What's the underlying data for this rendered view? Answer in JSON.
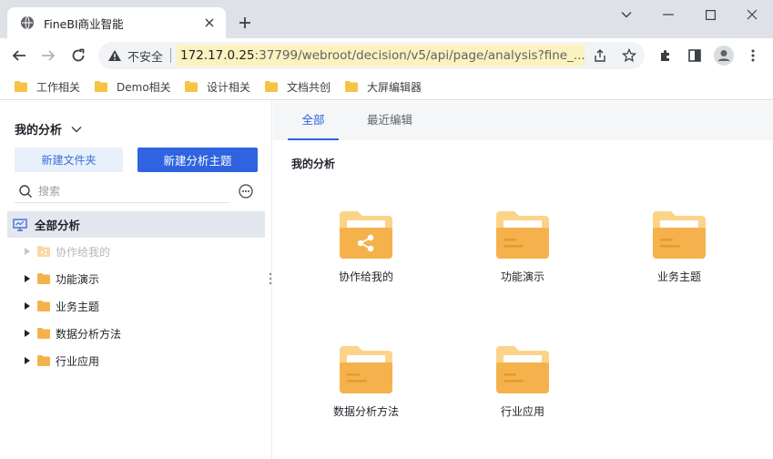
{
  "browser": {
    "tab_title": "FineBI商业智能",
    "security_label": "不安全",
    "url_host": "172.17.0.25",
    "url_rest": ":37799/webroot/decision/v5/api/page/analysis?fine_...",
    "bookmarks": [
      "工作相关",
      "Demo相关",
      "设计相关",
      "文档共创",
      "大屏编辑器"
    ]
  },
  "sidebar": {
    "title": "我的分析",
    "new_folder_label": "新建文件夹",
    "new_topic_label": "新建分析主题",
    "search_placeholder": "搜索",
    "tree": {
      "root_label": "全部分析",
      "items": [
        {
          "label": "协作给我的",
          "disabled": true
        },
        {
          "label": "功能演示",
          "disabled": false
        },
        {
          "label": "业务主题",
          "disabled": false
        },
        {
          "label": "数据分析方法",
          "disabled": false
        },
        {
          "label": "行业应用",
          "disabled": false
        }
      ]
    }
  },
  "main": {
    "tabs": [
      {
        "label": "全部",
        "active": true
      },
      {
        "label": "最近编辑",
        "active": false
      }
    ],
    "section_title": "我的分析",
    "cards": [
      {
        "label": "协作给我的",
        "icon": "shared-folder-icon"
      },
      {
        "label": "功能演示",
        "icon": "folder-icon"
      },
      {
        "label": "业务主题",
        "icon": "folder-icon"
      },
      {
        "label": "数据分析方法",
        "icon": "folder-icon"
      },
      {
        "label": "行业应用",
        "icon": "folder-icon"
      }
    ]
  },
  "colors": {
    "accent": "#2f63e0",
    "folder": "#f5b24c",
    "folder_light": "#fbd48a",
    "url_highlight": "#fbf2bf"
  }
}
